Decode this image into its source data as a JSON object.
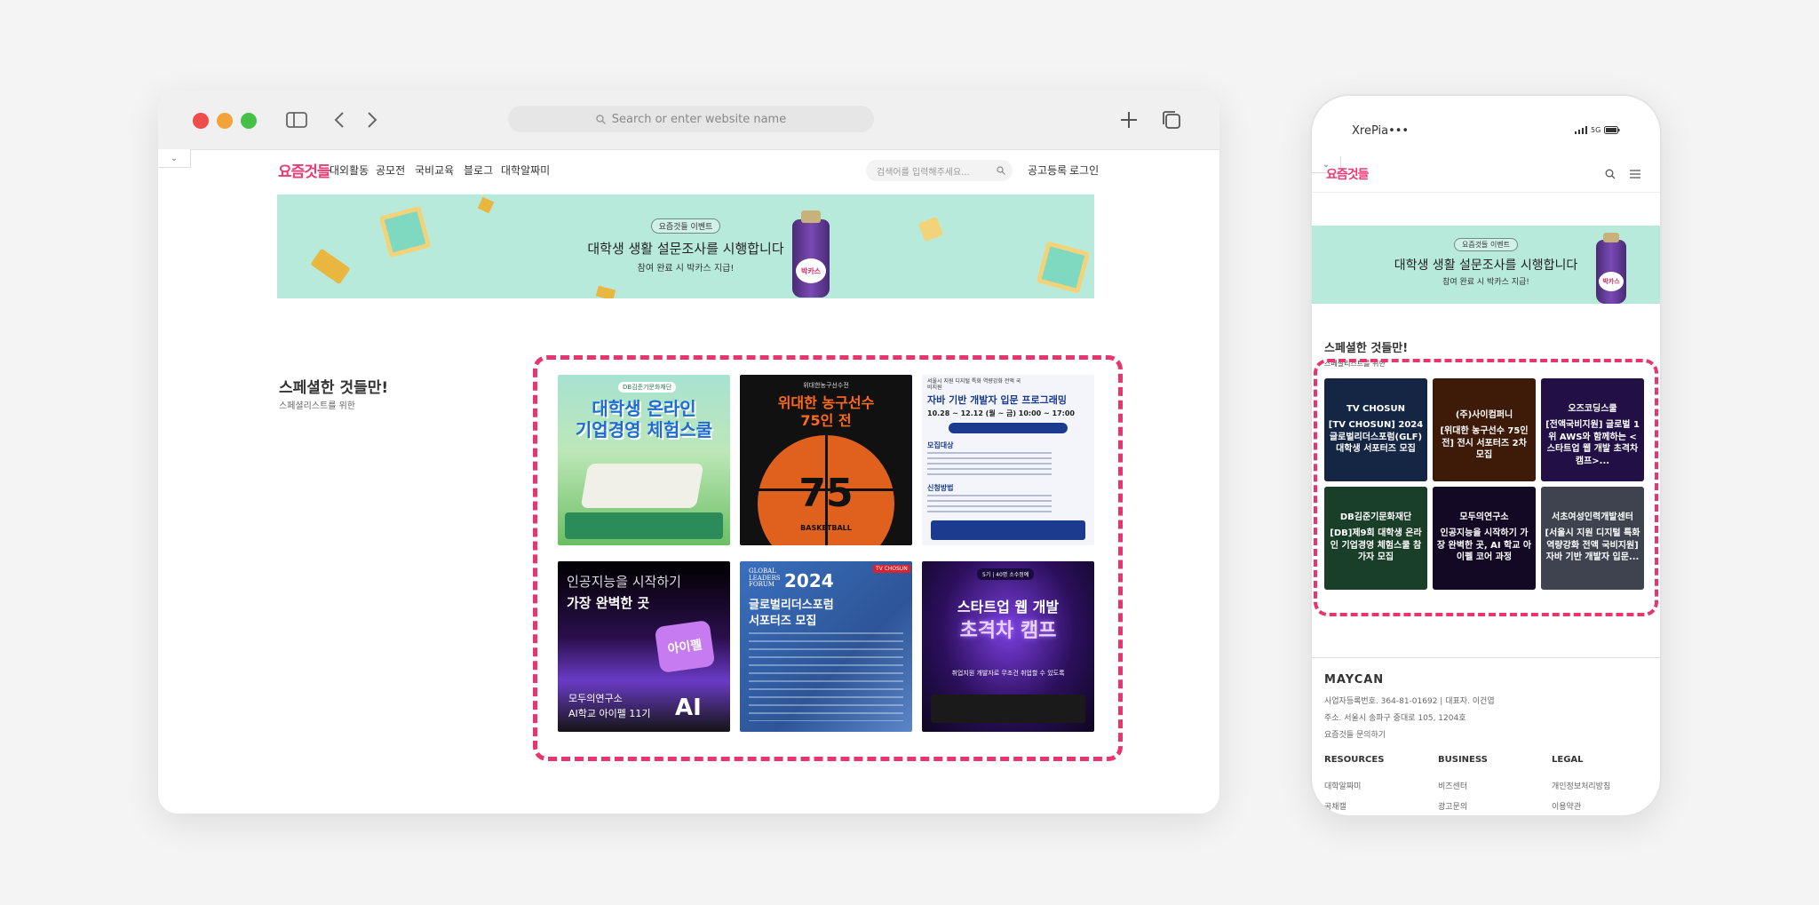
{
  "browser": {
    "url_placeholder": "Search or enter website name",
    "traffic_colors": [
      "#ee4d4a",
      "#f4a23a",
      "#47c045"
    ],
    "logo": "요즘것들",
    "nav": [
      "대외활동",
      "공모전",
      "국비교육",
      "블로그",
      "대학알짜미"
    ],
    "search_placeholder": "검색어를 입력해주세요...",
    "nav_right": [
      "공고등록",
      "로그인"
    ],
    "banner": {
      "pill": "요즘것들 이벤트",
      "title": "대학생 생활 설문조사를 시행합니다",
      "subtitle": "참여 완료 시 박카스 지급!",
      "bottle_text": "박카스"
    },
    "section": {
      "title": "스페셜한 것들만!",
      "subtitle": "스페셜리스트를 위한"
    },
    "cards": [
      {
        "line1": "대학생 온라인",
        "line2": "기업경영 체험스쿨",
        "tag": "DB김준기문화재단"
      },
      {
        "line1": "위대한 농구선수",
        "line2": "75인 전",
        "tag": "위대한농구선수전",
        "big": "75",
        "sub": "BASKETBALL"
      },
      {
        "line1": "서울시 지원 디지털 특화 역량강화 전액 국비지원",
        "line2": "자바 기반 개발자 입문 프로그래밍",
        "date": "10.28 ~ 12.12 (월 ~ 금) 10:00 ~ 17:00",
        "h1": "모집대상",
        "h2": "신청방법"
      },
      {
        "line1": "인공지능을 시작하기",
        "line2": "가장 완벽한 곳",
        "bubble": "아이펠",
        "org1": "모두의연구소",
        "org2": "AI학교 아이펠 11기",
        "ai": "AI"
      },
      {
        "line1": "2024",
        "line2": "글로벌리더스포럼",
        "line3": "서포터즈 모집",
        "brand1": "GLOBAL",
        "brand2": "LEADERS",
        "brand3": "FORUM",
        "chosun": "TV CHOSUN"
      },
      {
        "line1": "스타트업 웹 개발",
        "line2": "초격차 캠프",
        "badge": "5기 | 40명 소수정예",
        "desc": "취업지원 개발자로 무조건 취업할 수 있도록"
      }
    ]
  },
  "phone": {
    "status_time": "XrePia•••",
    "status_right": "5G",
    "logo": "요즘것들",
    "banner": {
      "pill": "요즘것들 이벤트",
      "title": "대학생 생활 설문조사를 시행합니다",
      "subtitle": "참여 완료 시 박카스 지급!",
      "bottle_text": "박카스"
    },
    "section": {
      "title": "스페셜한 것들만!",
      "subtitle": "스페셜리스트를 위한"
    },
    "cards": [
      {
        "org": "TV CHOSUN",
        "title": "[TV CHOSUN] 2024 글로벌리더스포럼(GLF) 대학생 서포터즈 모집"
      },
      {
        "org": "(주)사이컴퍼니",
        "title": "[위대한 농구선수 75인 전] 전시 서포터즈 2차 모집"
      },
      {
        "org": "오즈코딩스쿨",
        "title": "[전액국비지원] 글로벌 1위 AWS와 함께하는 <스타트업 웹 개발 초격차 캠프>..."
      },
      {
        "org": "DB김준기문화재단",
        "title": "[DB]제9회 대학생 온라인 기업경영 체험스쿨 참가자 모집"
      },
      {
        "org": "모두의연구소",
        "title": "인공지능을 시작하기 가장 완벽한 곳, AI 학교 아이펠 코어 과정"
      },
      {
        "org": "서초여성인력개발센터",
        "title": "[서울시 지원 디지털 특화 역량강화 전액 국비지원] 자바 기반 개발자 입문..."
      }
    ],
    "footer": {
      "brand": "MAYCAN",
      "lines": [
        "사업자등록번호. 364-81-01692 | 대표자. 이건엽",
        "주소. 서울시 송파구 중대로 105, 1204호",
        "요즘것들 문의하기"
      ],
      "columns": [
        {
          "title": "RESOURCES",
          "items": [
            "대학알짜미",
            "공채캘"
          ]
        },
        {
          "title": "BUSINESS",
          "items": [
            "비즈센터",
            "광고문의"
          ]
        },
        {
          "title": "LEGAL",
          "items": [
            "개인정보처리방침",
            "이용약관"
          ]
        }
      ]
    }
  }
}
